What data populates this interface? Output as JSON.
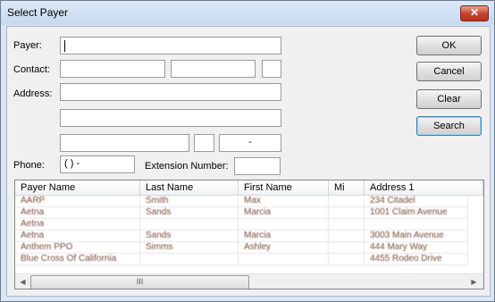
{
  "window": {
    "title": "Select Payer",
    "close_glyph": "✕"
  },
  "labels": {
    "payer": "Payer:",
    "contact": "Contact:",
    "address": "Address:",
    "phone": "Phone:",
    "extension": "Extension Number:"
  },
  "fields": {
    "payer": "",
    "contact_last": "",
    "contact_first": "",
    "contact_mi": "",
    "address1": "",
    "address2": "",
    "city": "",
    "state": "",
    "zip": "-",
    "phone": "(   )   -",
    "extension": ""
  },
  "buttons": {
    "ok": "OK",
    "cancel": "Cancel",
    "clear": "Clear",
    "search": "Search"
  },
  "table": {
    "columns": [
      "Payer Name",
      "Last Name",
      "First Name",
      "Mi",
      "Address 1"
    ],
    "rows": [
      [
        "AARP",
        "Smith",
        "Max",
        "",
        "234 Citadel"
      ],
      [
        "Aetna",
        "Sands",
        "Marcia",
        "",
        "1001 Claim Avenue"
      ],
      [
        "Aetna",
        "",
        "",
        "",
        ""
      ],
      [
        "Aetna",
        "Sands",
        "Marcia",
        "",
        "3003 Main Avenue"
      ],
      [
        "Anthem PPO",
        "Simms",
        "Ashley",
        "",
        "444 Mary Way"
      ],
      [
        "Blue Cross Of California",
        "",
        "",
        "",
        "4455 Rodeo Drive"
      ]
    ],
    "scroll_left": "◀",
    "scroll_right": "▶",
    "thumb_grip": "III"
  }
}
